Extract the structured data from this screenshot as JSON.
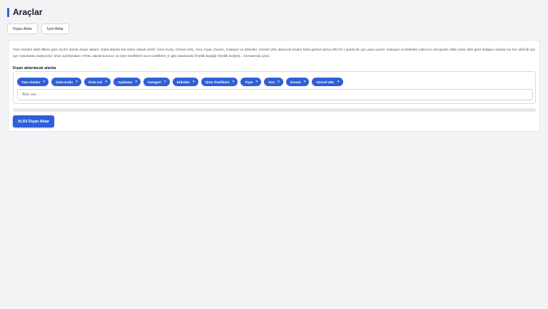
{
  "page": {
    "title": "Araçlar"
  },
  "tabs": [
    {
      "label": "Dışarı Aktar"
    },
    {
      "label": "İçeri Aktar"
    }
  ],
  "export_panel": {
    "description": "Tüm ürünleri aktif dillere göre XLSX olarak dışarı aktarır. Sabit alanlar tek sütun olarak verilir: Ürün Kodu, Görsel URL, Sıra, Fiyat, Durum, Kategori ve Etiketler. Görsel URL alanında birden fazla görsel varsa URL'ler | işareti ile yan yana yazılır. Kategori ve Etiketler yalnızca varsayılan dilde çıkar. Dile göre değişen alanlar ise her aktif dil için ayrı sütunlarla oluşturulur; ürün açıklamaları HTML olarak korunur ve ürün özellikleri urun-ozellikleri_tr gibi sütunlarda Özellik Başlığı:Özellik Değeri|... formatında çıkar.",
    "fields_label": "Dışarı aktarılacak alanlar",
    "selected_fields": [
      "Tüm Alanlar",
      "Ürün Kodu",
      "Ürün Adı",
      "Açıklama",
      "Kategori",
      "Etiketler",
      "Ürün Özellikleri",
      "Fiyat",
      "Sıra",
      "Durum",
      "Görsel URL"
    ],
    "chip_remove_glyph": "×",
    "search": {
      "placeholder": "Alan ara...",
      "value": ""
    },
    "progress": {
      "percent": 0
    },
    "export_button_label": "XLSX Dışarı Aktar"
  },
  "colors": {
    "accent": "#2f5fd8",
    "background": "#f3f3f5",
    "panel": "#ffffff"
  }
}
